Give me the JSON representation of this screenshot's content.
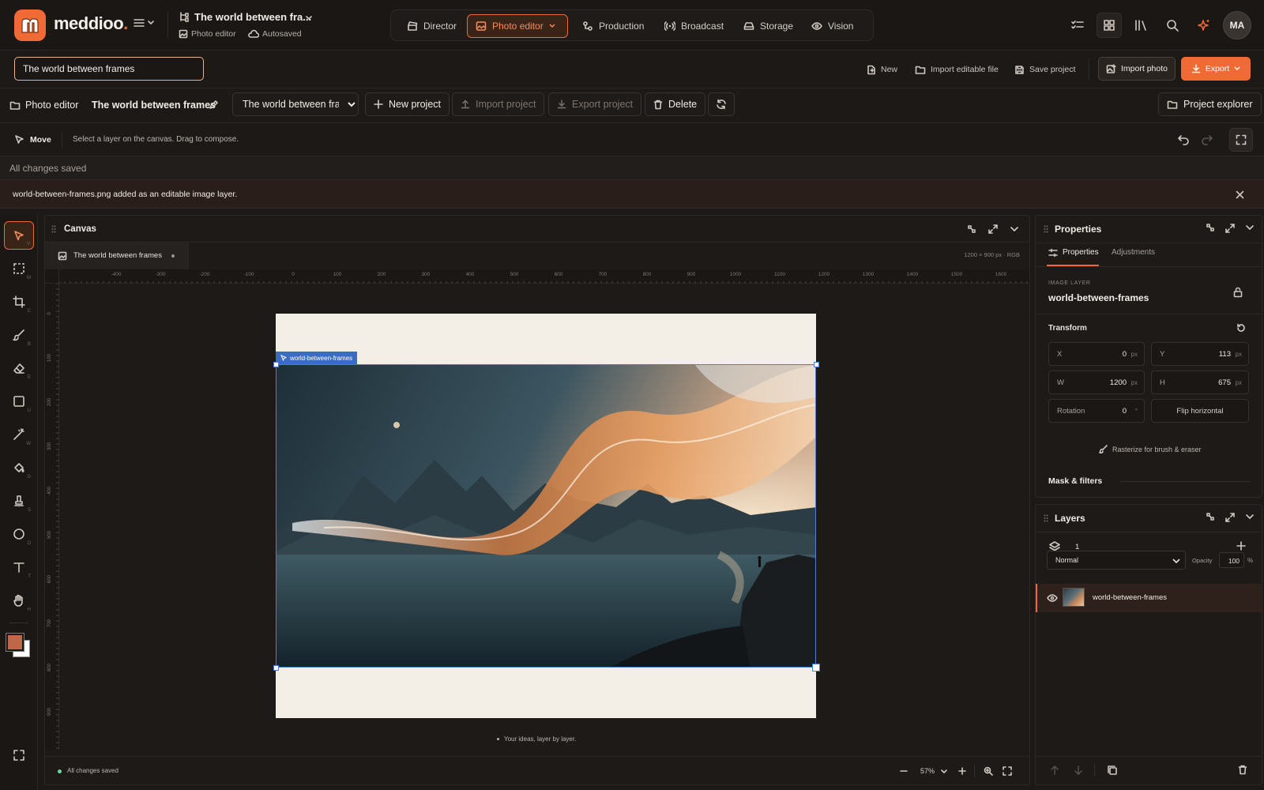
{
  "app": {
    "brand": "meddioo",
    "brand_dot": "."
  },
  "header": {
    "project_title": "The world between fra...",
    "crumb_app": "Photo editor",
    "crumb_status": "Autosaved",
    "nav": [
      {
        "label": "Director",
        "icon": "clapperboard-icon"
      },
      {
        "label": "Photo editor",
        "icon": "image-icon"
      },
      {
        "label": "Production",
        "icon": "nodes-icon"
      },
      {
        "label": "Broadcast",
        "icon": "broadcast-icon"
      },
      {
        "label": "Storage",
        "icon": "hard-drive-icon"
      },
      {
        "label": "Vision",
        "icon": "eye-icon"
      }
    ],
    "avatar_initials": "MA"
  },
  "toolbar_row": {
    "title_value": "The world between frames",
    "new_label": "New",
    "import_editable_label": "Import editable file",
    "save_project_label": "Save project",
    "import_photo_label": "Import photo",
    "export_label": "Export"
  },
  "project_row": {
    "module_label": "Photo editor",
    "project_name": "The world between frames",
    "project_select_value": "The world between frames",
    "new_project_label": "New project",
    "import_project_label": "Import project",
    "export_project_label": "Export project",
    "delete_label": "Delete",
    "project_explorer_label": "Project explorer"
  },
  "tool_row": {
    "tool_name": "Move",
    "hint": "Select a layer on the canvas. Drag to compose."
  },
  "status": {
    "saved_text": "All changes saved"
  },
  "toast": {
    "message": "world-between-frames.png added as an editable image layer."
  },
  "tools": [
    {
      "name": "move-tool",
      "key": "V"
    },
    {
      "name": "marquee-tool",
      "key": "M"
    },
    {
      "name": "crop-tool",
      "key": "C"
    },
    {
      "name": "brush-tool",
      "key": "B"
    },
    {
      "name": "eraser-tool",
      "key": "E"
    },
    {
      "name": "rectangle-tool",
      "key": "U"
    },
    {
      "name": "magic-wand-tool",
      "key": "W"
    },
    {
      "name": "fill-tool",
      "key": "G"
    },
    {
      "name": "stamp-tool",
      "key": "S"
    },
    {
      "name": "ellipse-tool",
      "key": "O"
    },
    {
      "name": "text-tool",
      "key": "T"
    },
    {
      "name": "hand-tool",
      "key": "H"
    }
  ],
  "colors": {
    "foreground": "#c0674a",
    "background": "#ffffff",
    "accent": "#ef6a35",
    "selection": "#4a7fd4"
  },
  "canvas": {
    "panel_title": "Canvas",
    "doc_tab": "The world between frames",
    "doc_info": "1200 × 900 px · RGB",
    "ruler_h": [
      "-400",
      "-300",
      "-200",
      "-100",
      "0",
      "100",
      "200",
      "300",
      "400",
      "500",
      "600",
      "700",
      "800",
      "900",
      "1000",
      "1100",
      "1200",
      "1300",
      "1400",
      "1500",
      "1600"
    ],
    "ruler_v": [
      "0",
      "100",
      "200",
      "300",
      "400",
      "500",
      "600",
      "700",
      "800",
      "900"
    ],
    "layer_chip": "world-between-frames",
    "tagline": "Your ideas, layer by layer.",
    "footer_status": "All changes saved",
    "zoom": "57%"
  },
  "properties": {
    "panel_title": "Properties",
    "tab_properties": "Properties",
    "tab_adjustments": "Adjustments",
    "layer_type": "IMAGE LAYER",
    "layer_name": "world-between-frames",
    "transform_label": "Transform",
    "x": {
      "label": "X",
      "value": "0",
      "unit": "px"
    },
    "y": {
      "label": "Y",
      "value": "113",
      "unit": "px"
    },
    "w": {
      "label": "W",
      "value": "1200",
      "unit": "px"
    },
    "h": {
      "label": "H",
      "value": "675",
      "unit": "px"
    },
    "rotation": {
      "label": "Rotation",
      "value": "0",
      "unit": "°"
    },
    "flip_label": "Flip horizontal",
    "rasterize_label": "Rasterize for brush & eraser",
    "mask_label": "Mask & filters"
  },
  "layers": {
    "panel_title": "Layers",
    "count": "1",
    "blend_mode": "Normal",
    "opacity_label": "Opacity",
    "opacity_value": "100",
    "opacity_unit": "%",
    "items": [
      {
        "name": "world-between-frames"
      }
    ]
  }
}
